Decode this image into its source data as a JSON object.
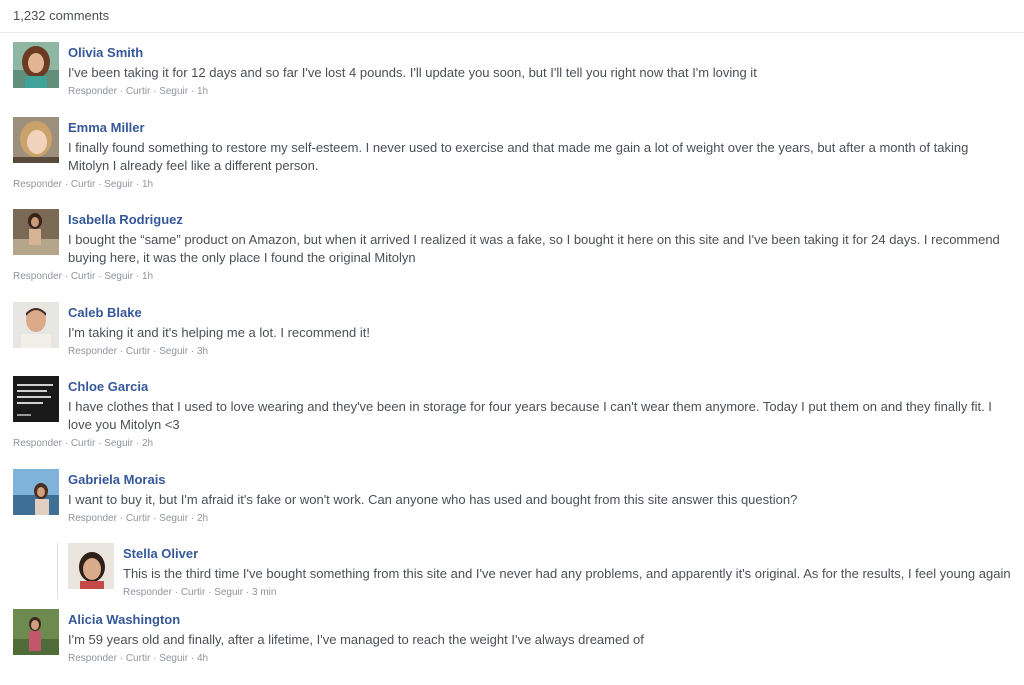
{
  "comments_count": "1,232 comments",
  "actions": {
    "reply": "Responder",
    "like": "Curtir",
    "follow": "Seguir",
    "dot": "·"
  },
  "comments": [
    {
      "name": "Olivia Smith",
      "text": "I've been taking it for 12 days and so far I've lost 4 pounds. I'll update you soon, but I'll tell you right now that I'm loving it",
      "time": "1h"
    },
    {
      "name": "Emma Miller",
      "text": "I finally found something to restore my self-esteem. I never used to exercise and that made me gain a lot of weight over the years, but after a month of taking Mitolyn I already feel like a different person.",
      "time": "1h"
    },
    {
      "name": "Isabella Rodriguez",
      "text": "I bought the “same” product on Amazon, but when it arrived I realized it was a fake, so I bought it here on this site and I've been taking it for 24 days. I recommend buying here, it was the only place I found the original Mitolyn",
      "time": "1h"
    },
    {
      "name": "Caleb Blake",
      "text": "I'm taking it and it's helping me a lot. I recommend it!",
      "time": "3h"
    },
    {
      "name": "Chloe Garcia",
      "text": "I have clothes that I used to love wearing and they've been in storage for four years because I can't wear them anymore. Today I put them on and they finally fit. I love you Mitolyn <3",
      "time": "2h"
    },
    {
      "name": "Gabriela Morais",
      "text": "I want to buy it, but I'm afraid it's fake or won't work. Can anyone who has used and bought from this site answer this question?",
      "time": "2h"
    },
    {
      "name": "Stella Oliver",
      "text": "This is the third time I've bought something from this site and I've never had any problems, and apparently it's original. As for the results, I feel young again",
      "time": "3 min"
    },
    {
      "name": "Alicia Washington",
      "text": "I'm 59 years old and finally, after a lifetime, I've managed to reach the weight I've always dreamed of",
      "time": "4h"
    }
  ]
}
